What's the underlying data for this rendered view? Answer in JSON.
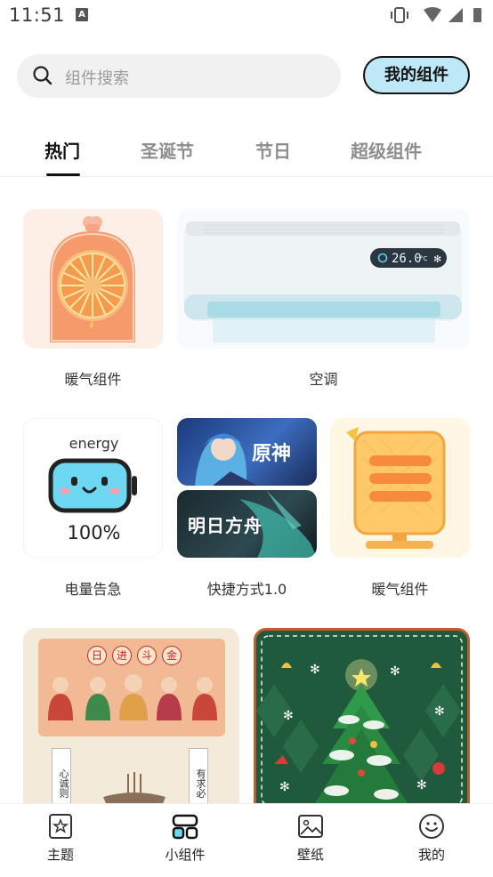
{
  "status_bar": {
    "time": "11:51",
    "notification_letter": "A"
  },
  "search": {
    "placeholder": "组件搜索"
  },
  "my_widgets_button": "我的组件",
  "tabs": [
    {
      "label": "热门",
      "active": true
    },
    {
      "label": "圣诞节",
      "active": false
    },
    {
      "label": "节日",
      "active": false
    },
    {
      "label": "超级组件",
      "active": false
    }
  ],
  "widgets": {
    "heater1": {
      "label": "暖气组件"
    },
    "aircon": {
      "label": "空调",
      "display": "26.0",
      "unit": "°C"
    },
    "battery": {
      "label": "电量告急",
      "title": "energy",
      "percent": "100%"
    },
    "shortcut": {
      "label": "快捷方式1.0",
      "game1": "原神",
      "game2": "明日方舟"
    },
    "heater2": {
      "label": "暖气组件"
    },
    "fortune": {
      "banner": [
        "日",
        "进",
        "斗",
        "金"
      ],
      "scroll_left": "心诚则",
      "scroll_right": "有求必"
    }
  },
  "bottom_nav": [
    {
      "label": "主题",
      "icon": "theme-icon",
      "active": false
    },
    {
      "label": "小组件",
      "icon": "widget-icon",
      "active": true
    },
    {
      "label": "壁纸",
      "icon": "wallpaper-icon",
      "active": false
    },
    {
      "label": "我的",
      "icon": "profile-icon",
      "active": false
    }
  ],
  "colors": {
    "accent_button": "#bde8f7",
    "christmas_green": "#1f5a3c",
    "heater_orange": "#f69a6c"
  }
}
